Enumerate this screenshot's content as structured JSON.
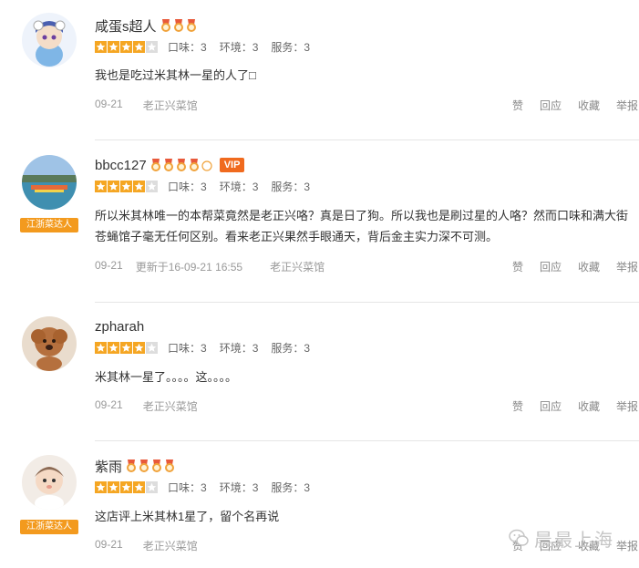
{
  "reviews": [
    {
      "username": "咸蛋s超人",
      "rating": 4,
      "scores": [
        "口味：3",
        "环境：3",
        "服务：3"
      ],
      "content": "我也是吃过米其林一星的人了□",
      "date": "09-21",
      "updated": "",
      "shop": "老正兴菜馆",
      "badge": "",
      "vip": ""
    },
    {
      "username": "bbcc127",
      "rating": 4,
      "scores": [
        "口味：3",
        "环境：3",
        "服务：3"
      ],
      "content": "所以米其林唯一的本帮菜竟然是老正兴咯？真是日了狗。所以我也是刷过星的人咯？然而口味和满大街苍蝇馆子毫无任何区别。看来老正兴果然手眼通天，背后金主实力深不可测。",
      "date": "09-21",
      "updated": "更新于16-09-21 16:55",
      "shop": "老正兴菜馆",
      "badge": "江浙菜达人",
      "vip": "VIP"
    },
    {
      "username": "zpharah",
      "rating": 4,
      "scores": [
        "口味：3",
        "环境：3",
        "服务：3"
      ],
      "content": "米其林一星了。。。。这。。。。",
      "date": "09-21",
      "updated": "",
      "shop": "老正兴菜馆",
      "badge": "",
      "vip": ""
    },
    {
      "username": "紫雨",
      "rating": 4,
      "scores": [
        "口味：3",
        "环境：3",
        "服务：3"
      ],
      "content": "这店评上米其林1星了，留个名再说",
      "date": "09-21",
      "updated": "",
      "shop": "老正兴菜馆",
      "badge": "江浙菜达人",
      "vip": ""
    }
  ],
  "actions": {
    "like": "赞",
    "reply": "回应",
    "favorite": "收藏",
    "report": "举报"
  },
  "watermark": "晨最上海",
  "colors": {
    "star_on": "#f5a623",
    "star_off": "#dddddd",
    "badge": "#f39a1e",
    "vip": "#f06a1e",
    "medal": "#e8593a"
  }
}
